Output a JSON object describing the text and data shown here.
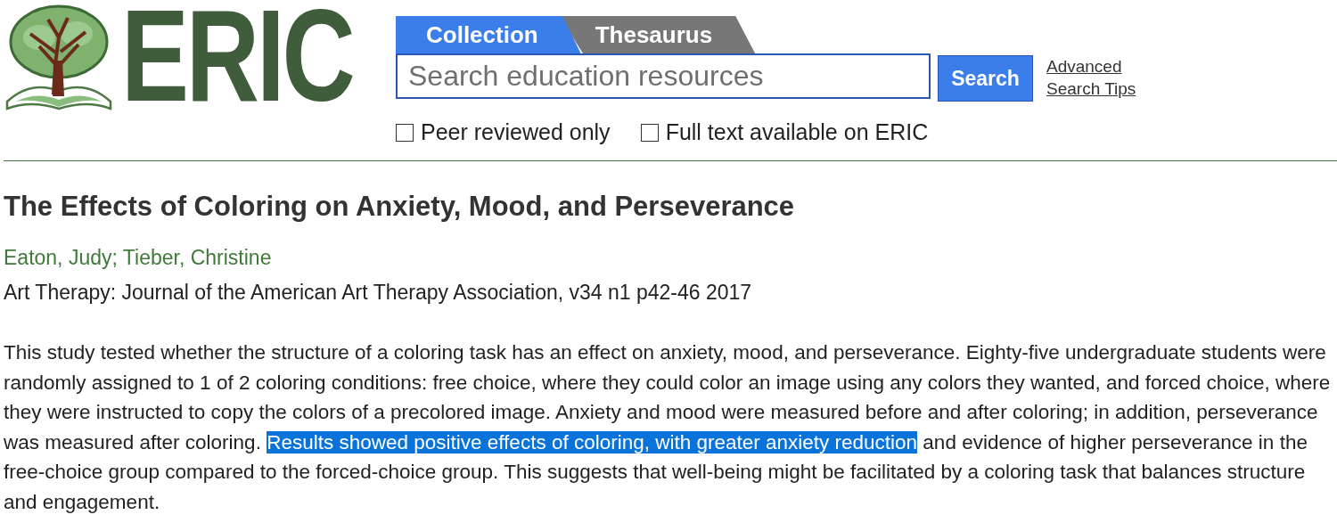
{
  "logo": {
    "text": "ERIC"
  },
  "tabs": [
    {
      "label": "Collection",
      "selected": true
    },
    {
      "label": "Thesaurus",
      "selected": false
    }
  ],
  "search": {
    "placeholder": "Search education resources",
    "button": "Search"
  },
  "links": [
    "Advanced",
    "Search Tips"
  ],
  "filters": [
    {
      "label": "Peer reviewed only",
      "checked": false
    },
    {
      "label": "Full text available on ERIC",
      "checked": false
    }
  ],
  "record": {
    "title": "The Effects of Coloring on Anxiety, Mood, and Perseverance",
    "authors": "Eaton, Judy; Tieber, Christine",
    "source": "Art Therapy: Journal of the American Art Therapy Association, v34 n1 p42-46 2017",
    "abstract": [
      {
        "text": "This study tested whether the structure of a coloring task has an effect on anxiety, mood, and perseverance. Eighty-five undergraduate students were randomly assigned to 1 of 2 coloring conditions: free choice, where they could color an image using any colors they wanted, and forced choice, where they were instructed to copy the colors of a precolored image. Anxiety and mood were measured before and after coloring; in addition, perseverance was measured after coloring. ",
        "selected": false
      },
      {
        "text": "Results showed positive effects of coloring, with greater anxiety reduction",
        "selected": true
      },
      {
        "text": " and evidence of higher perseverance in the free-choice group compared to the forced-choice group. This suggests that well-being might be facilitated by a coloring task that balances structure and engagement.",
        "selected": false
      }
    ]
  }
}
